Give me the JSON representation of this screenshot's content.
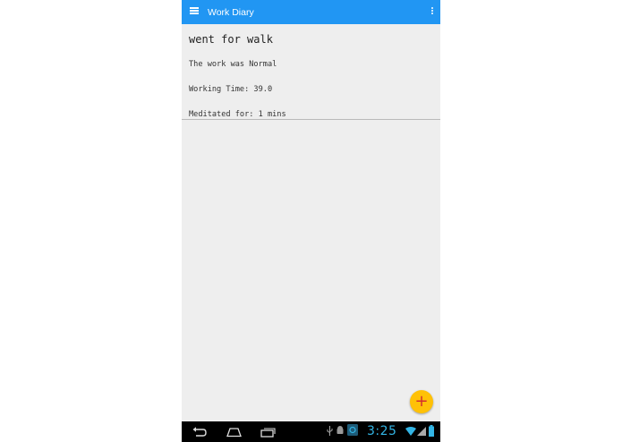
{
  "app_bar": {
    "title": "Work Diary",
    "menu_icon": "hamburger-menu-icon",
    "overflow_icon": "more-vert-icon",
    "color": "#2196f3"
  },
  "entry": {
    "title": "went for walk",
    "work_line": "The work was Normal",
    "time_line": "Working Time: 39.0",
    "meditation_line": "Meditated for: 1 mins"
  },
  "fab": {
    "icon": "plus-icon",
    "label": "+",
    "color": "#ffc107",
    "icon_color": "#d32f2f"
  },
  "system_bar": {
    "back_icon": "back-icon",
    "home_icon": "home-icon",
    "recents_icon": "recents-icon",
    "status_icons": [
      "usb-icon",
      "android-debug-icon",
      "app-notification-icon",
      "wifi-icon",
      "signal-icon",
      "battery-icon"
    ],
    "time": "3:25"
  }
}
